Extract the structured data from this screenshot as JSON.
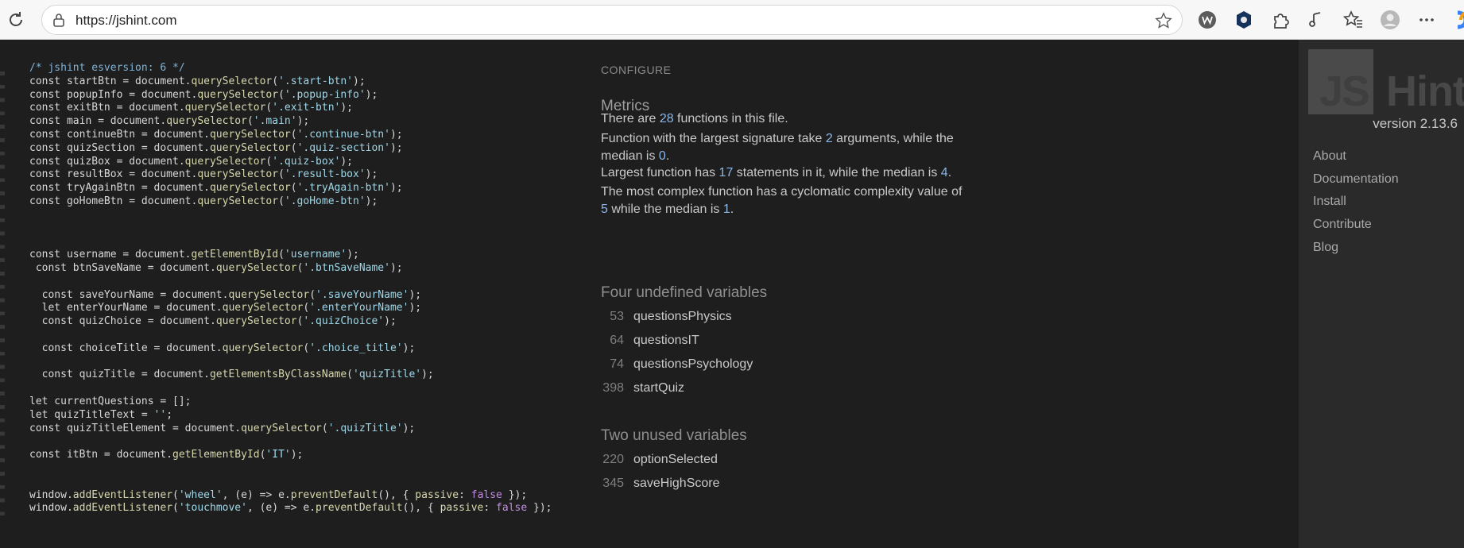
{
  "browser": {
    "url": "https://jshint.com"
  },
  "code": {
    "lines": [
      {
        "parts": [
          {
            "t": "/* jshint esversion: 6 */",
            "c": "c"
          }
        ]
      },
      {
        "parts": [
          {
            "t": "const startBtn = document."
          },
          {
            "t": "querySelector",
            "c": "m"
          },
          {
            "t": "("
          },
          {
            "t": "'.start-btn'",
            "c": "s"
          },
          {
            "t": ");"
          }
        ]
      },
      {
        "parts": [
          {
            "t": "const popupInfo = document."
          },
          {
            "t": "querySelector",
            "c": "m"
          },
          {
            "t": "("
          },
          {
            "t": "'.popup-info'",
            "c": "s"
          },
          {
            "t": ");"
          }
        ]
      },
      {
        "parts": [
          {
            "t": "const exitBtn = document."
          },
          {
            "t": "querySelector",
            "c": "m"
          },
          {
            "t": "("
          },
          {
            "t": "'.exit-btn'",
            "c": "s"
          },
          {
            "t": ");"
          }
        ]
      },
      {
        "parts": [
          {
            "t": "const main = document."
          },
          {
            "t": "querySelector",
            "c": "m"
          },
          {
            "t": "("
          },
          {
            "t": "'.main'",
            "c": "s"
          },
          {
            "t": ");"
          }
        ]
      },
      {
        "parts": [
          {
            "t": "const continueBtn = document."
          },
          {
            "t": "querySelector",
            "c": "m"
          },
          {
            "t": "("
          },
          {
            "t": "'.continue-btn'",
            "c": "s"
          },
          {
            "t": ");"
          }
        ]
      },
      {
        "parts": [
          {
            "t": "const quizSection = document."
          },
          {
            "t": "querySelector",
            "c": "m"
          },
          {
            "t": "("
          },
          {
            "t": "'.quiz-section'",
            "c": "s"
          },
          {
            "t": ");"
          }
        ]
      },
      {
        "parts": [
          {
            "t": "const quizBox = document."
          },
          {
            "t": "querySelector",
            "c": "m"
          },
          {
            "t": "("
          },
          {
            "t": "'.quiz-box'",
            "c": "s"
          },
          {
            "t": ");"
          }
        ]
      },
      {
        "parts": [
          {
            "t": "const resultBox = document."
          },
          {
            "t": "querySelector",
            "c": "m"
          },
          {
            "t": "("
          },
          {
            "t": "'.result-box'",
            "c": "s"
          },
          {
            "t": ");"
          }
        ]
      },
      {
        "parts": [
          {
            "t": "const tryAgainBtn = document."
          },
          {
            "t": "querySelector",
            "c": "m"
          },
          {
            "t": "("
          },
          {
            "t": "'.tryAgain-btn'",
            "c": "s"
          },
          {
            "t": ");"
          }
        ]
      },
      {
        "parts": [
          {
            "t": "const goHomeBtn = document."
          },
          {
            "t": "querySelector",
            "c": "m"
          },
          {
            "t": "("
          },
          {
            "t": "'.goHome-btn'",
            "c": "s"
          },
          {
            "t": ");"
          }
        ]
      },
      {
        "parts": []
      },
      {
        "parts": []
      },
      {
        "parts": []
      },
      {
        "parts": [
          {
            "t": "const username = document."
          },
          {
            "t": "getElementById",
            "c": "m"
          },
          {
            "t": "("
          },
          {
            "t": "'username'",
            "c": "s"
          },
          {
            "t": ");"
          }
        ]
      },
      {
        "parts": [
          {
            "t": " const btnSaveName = document."
          },
          {
            "t": "querySelector",
            "c": "m"
          },
          {
            "t": "("
          },
          {
            "t": "'.btnSaveName'",
            "c": "s"
          },
          {
            "t": ");"
          }
        ]
      },
      {
        "parts": []
      },
      {
        "parts": [
          {
            "t": "  const saveYourName = document."
          },
          {
            "t": "querySelector",
            "c": "m"
          },
          {
            "t": "("
          },
          {
            "t": "'.saveYourName'",
            "c": "s"
          },
          {
            "t": ");"
          }
        ]
      },
      {
        "parts": [
          {
            "t": "  let enterYourName = document."
          },
          {
            "t": "querySelector",
            "c": "m"
          },
          {
            "t": "("
          },
          {
            "t": "'.enterYourName'",
            "c": "s"
          },
          {
            "t": ");"
          }
        ]
      },
      {
        "parts": [
          {
            "t": "  const quizChoice = document."
          },
          {
            "t": "querySelector",
            "c": "m"
          },
          {
            "t": "("
          },
          {
            "t": "'.quizChoice'",
            "c": "s"
          },
          {
            "t": ");"
          }
        ]
      },
      {
        "parts": []
      },
      {
        "parts": [
          {
            "t": "  const choiceTitle = document."
          },
          {
            "t": "querySelector",
            "c": "m"
          },
          {
            "t": "("
          },
          {
            "t": "'.choice_title'",
            "c": "s"
          },
          {
            "t": ");"
          }
        ]
      },
      {
        "parts": []
      },
      {
        "parts": [
          {
            "t": "  const quizTitle = document."
          },
          {
            "t": "getElementsByClassName",
            "c": "m"
          },
          {
            "t": "("
          },
          {
            "t": "'quizTitle'",
            "c": "s"
          },
          {
            "t": ");"
          }
        ]
      },
      {
        "parts": []
      },
      {
        "parts": [
          {
            "t": "let currentQuestions = [];"
          }
        ]
      },
      {
        "parts": [
          {
            "t": "let quizTitleText = "
          },
          {
            "t": "''",
            "c": "s"
          },
          {
            "t": ";"
          }
        ]
      },
      {
        "parts": [
          {
            "t": "const quizTitleElement = document."
          },
          {
            "t": "querySelector",
            "c": "m"
          },
          {
            "t": "("
          },
          {
            "t": "'.quizTitle'",
            "c": "s"
          },
          {
            "t": ");"
          }
        ]
      },
      {
        "parts": []
      },
      {
        "parts": [
          {
            "t": "const itBtn = document."
          },
          {
            "t": "getElementById",
            "c": "m"
          },
          {
            "t": "("
          },
          {
            "t": "'IT'",
            "c": "s"
          },
          {
            "t": ");"
          }
        ]
      },
      {
        "parts": []
      },
      {
        "parts": []
      },
      {
        "parts": [
          {
            "t": "window."
          },
          {
            "t": "addEventListener",
            "c": "m"
          },
          {
            "t": "("
          },
          {
            "t": "'wheel'",
            "c": "s"
          },
          {
            "t": ", (e) => e."
          },
          {
            "t": "preventDefault",
            "c": "m"
          },
          {
            "t": "(), { "
          },
          {
            "t": "passive",
            "c": "m"
          },
          {
            "t": ": "
          },
          {
            "t": "false",
            "c": "k"
          },
          {
            "t": " });"
          }
        ]
      },
      {
        "parts": [
          {
            "t": "window."
          },
          {
            "t": "addEventListener",
            "c": "m"
          },
          {
            "t": "("
          },
          {
            "t": "'touchmove'",
            "c": "s"
          },
          {
            "t": ", (e) => e."
          },
          {
            "t": "preventDefault",
            "c": "m"
          },
          {
            "t": "(), { "
          },
          {
            "t": "passive",
            "c": "m"
          },
          {
            "t": ": "
          },
          {
            "t": "false",
            "c": "k"
          },
          {
            "t": " });"
          }
        ]
      }
    ]
  },
  "report": {
    "configure": "CONFIGURE",
    "metrics_title": "Metrics",
    "metrics": [
      {
        "parts": [
          "There are ",
          {
            "n": "28"
          },
          " functions in this file."
        ]
      },
      {
        "parts": [
          "Function with the largest signature take ",
          {
            "n": "2"
          },
          " arguments, while the median is ",
          {
            "n": "0"
          },
          "."
        ]
      },
      {
        "parts": [
          "Largest function has ",
          {
            "n": "17"
          },
          " statements in it, while the median is ",
          {
            "n": "4"
          },
          "."
        ]
      },
      {
        "parts": [
          "The most complex function has a cyclomatic complexity value of ",
          {
            "n": "5"
          },
          " while the median is ",
          {
            "n": "1"
          },
          "."
        ]
      }
    ],
    "undefined_title": "Four undefined variables",
    "undefined": [
      {
        "line": "53",
        "name": "questionsPhysics"
      },
      {
        "line": "64",
        "name": "questionsIT"
      },
      {
        "line": "74",
        "name": "questionsPsychology"
      },
      {
        "line": "398",
        "name": "startQuiz"
      }
    ],
    "unused_title": "Two unused variables",
    "unused": [
      {
        "line": "220",
        "name": "optionSelected"
      },
      {
        "line": "345",
        "name": "saveHighScore"
      }
    ]
  },
  "sidebar": {
    "logo_js": "JS",
    "logo_hint": "Hint",
    "version": "version 2.13.6",
    "nav": [
      "About",
      "Documentation",
      "Install",
      "Contribute",
      "Blog"
    ]
  }
}
